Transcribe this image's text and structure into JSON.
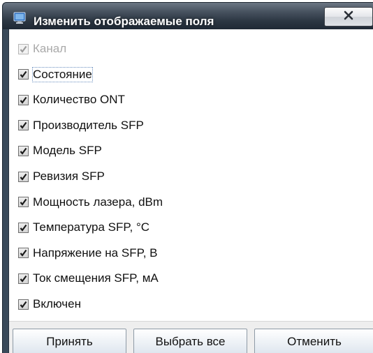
{
  "window": {
    "title": "Изменить отображаемые поля",
    "close_symbol": "X",
    "app_icon": "monitor-icon"
  },
  "fields": [
    {
      "label": "Канал",
      "checked": true,
      "enabled": false
    },
    {
      "label": "Состояние",
      "checked": true,
      "enabled": true,
      "focused": true
    },
    {
      "label": "Количество ONT",
      "checked": true,
      "enabled": true
    },
    {
      "label": "Производитель SFP",
      "checked": true,
      "enabled": true
    },
    {
      "label": "Модель SFP",
      "checked": true,
      "enabled": true
    },
    {
      "label": "Ревизия SFP",
      "checked": true,
      "enabled": true
    },
    {
      "label": "Мощность лазера, dBm",
      "checked": true,
      "enabled": true
    },
    {
      "label": "Температура SFP, °C",
      "checked": true,
      "enabled": true
    },
    {
      "label": "Напряжение на SFP, В",
      "checked": true,
      "enabled": true
    },
    {
      "label": "Ток смещения SFP, мА",
      "checked": true,
      "enabled": true
    },
    {
      "label": "Включен",
      "checked": true,
      "enabled": true
    }
  ],
  "buttons": {
    "accept": "Принять",
    "select_all": "Выбрать все",
    "cancel": "Отменить"
  },
  "colors": {
    "titlebar": "#2b3642",
    "title_text": "#ffffff",
    "disabled_text": "#a9a9a9",
    "button_border": "#8e9aa6"
  }
}
